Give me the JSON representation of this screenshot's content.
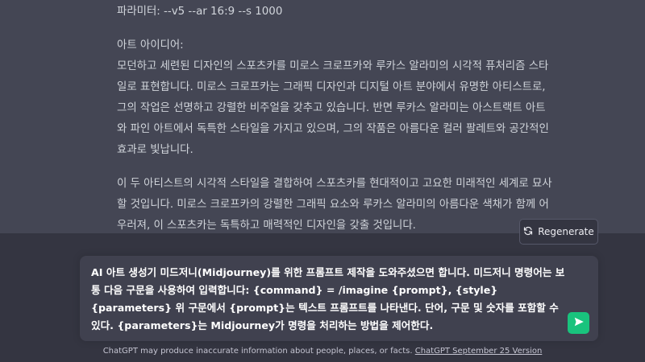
{
  "conversation": {
    "params_line": "파라미터: --v5 --ar 16:9 --s 1000",
    "art_idea_heading": "아트 아이디어:",
    "art_idea_body": "모던하고 세련된 디자인의 스포츠카를 미로스 크로프카와 루카스 알라미의 시각적 퓨처리즘 스타일로 표현합니다. 미로스 크로프카는 그래픽 디자인과 디지털 아트 분야에서 유명한 아티스트로, 그의 작업은 선명하고 강렬한 비주얼을 갖추고 있습니다. 반면 루카스 알라미는 아스트랙트 아트와 파인 아트에서 독특한 스타일을 가지고 있으며, 그의 작품은 아름다운 컬러 팔레트와 공간적인 효과로 빛납니다.",
    "paragraph_2": "이 두 아티스트의 시각적 스타일을 결합하여 스포츠카를 현대적이고 고요한 미래적인 세계로 묘사할 것입니다. 미로스 크로프카의 강렬한 그래픽 요소와 루카스 알라미의 아름다운 색채가 함께 어우러져, 이 스포츠카는 독특하고 매력적인 디자인을 갖출 것입니다."
  },
  "regenerate": {
    "label": "Regenerate",
    "icon": "refresh-icon"
  },
  "composer": {
    "value": "AI 아트 생성기 미드저니(Midjourney)를 위한 프롬프트 제작을 도와주셨으면 합니다. 미드저니 명령어는 보통 다음 구문을 사용하여 입력합니다: {command} = /imagine {prompt}, {style} {parameters} 위 구문에서 {prompt}는 텍스트 프롬프트를 나타낸다. 단어, 구문 및 숫자를 포함할 수 있다. {parameters}는 Midjourney가 명령을 처리하는 방법을 제어한다.",
    "send_icon": "send-icon"
  },
  "footer": {
    "disclaimer": "ChatGPT may produce inaccurate information about people, places, or facts. ",
    "version_link": "ChatGPT September 25 Version"
  },
  "colors": {
    "chat_bg": "#444654",
    "page_bg": "#343541",
    "composer_bg": "#40414f",
    "send_green": "#19c37d"
  }
}
